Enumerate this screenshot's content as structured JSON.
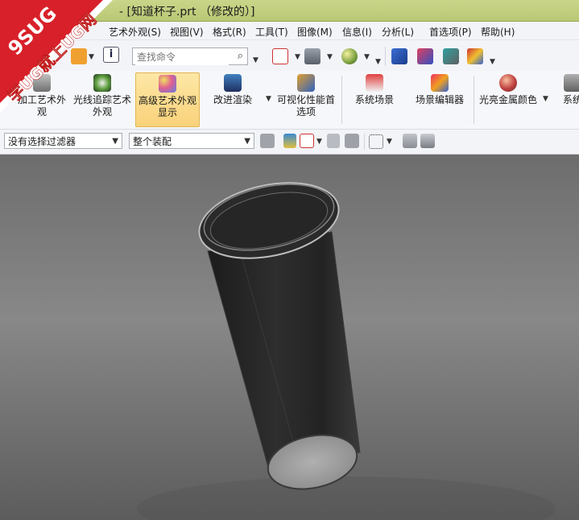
{
  "window": {
    "title": "- [知道杯子.prt （修改的）]"
  },
  "menu": [
    "艺术外观(S)",
    "视图(V)",
    "格式(R)",
    "工具(T)",
    "图像(M)",
    "信息(I)",
    "分析(L)",
    "首选项(P)",
    "帮助(H)"
  ],
  "search": {
    "placeholder": "查找命令"
  },
  "ribbon": [
    {
      "label": "加工艺术外观",
      "icon": "material-icon"
    },
    {
      "label": "光线追踪艺术外观",
      "icon": "raytrace-icon"
    },
    {
      "label": "高级艺术外观显示",
      "icon": "advanced-studio-icon"
    },
    {
      "label": "改进渲染",
      "icon": "render-icon"
    },
    {
      "label": "可视化性能首选项",
      "icon": "visual-prefs-icon"
    },
    {
      "label": "系统场景",
      "icon": "system-scene-icon"
    },
    {
      "label": "场景编辑器",
      "icon": "scene-editor-icon"
    },
    {
      "label": "光亮金属颜色",
      "icon": "metal-color-icon"
    },
    {
      "label": "系统",
      "icon": "system-icon"
    }
  ],
  "filters": {
    "selection_filter": "没有选择过滤器",
    "scope": "整个装配"
  },
  "watermark": {
    "line1": "9SUG",
    "line2": "学UG就上UG网"
  },
  "colors": {
    "titlebar": "#c0cd7c",
    "ribbon_active": "#f9d27a",
    "watermark_red": "#d8202a"
  }
}
